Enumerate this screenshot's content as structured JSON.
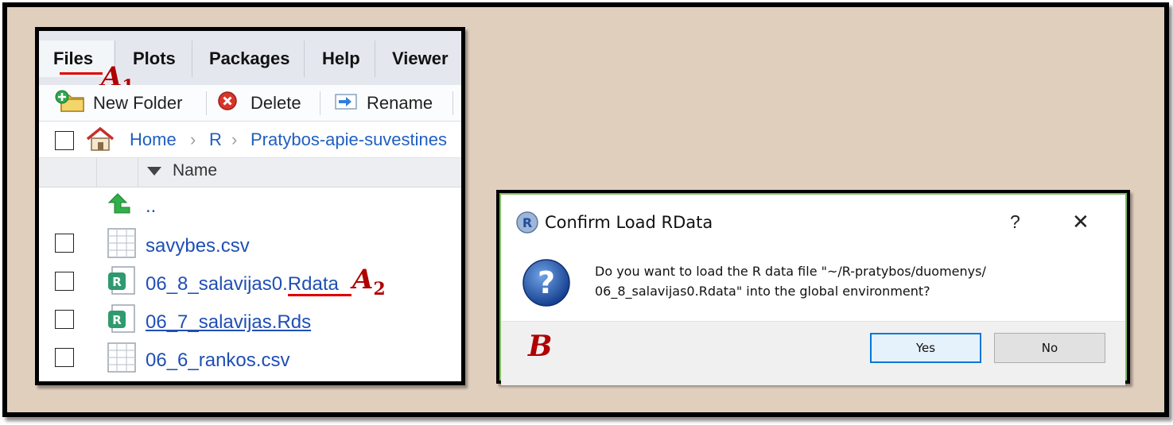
{
  "files_pane": {
    "tabs": [
      {
        "label": "Files",
        "active": true
      },
      {
        "label": "Plots",
        "active": false
      },
      {
        "label": "Packages",
        "active": false
      },
      {
        "label": "Help",
        "active": false
      },
      {
        "label": "Viewer",
        "active": false
      }
    ],
    "toolbar": {
      "new_folder": "New Folder",
      "delete": "Delete",
      "rename": "Rename"
    },
    "breadcrumb": [
      "Home",
      "R",
      "Pratybos-apie-suvestines"
    ],
    "column_header": "Name",
    "parent_dir": "..",
    "files": [
      {
        "name": "savybes.csv",
        "type": "csv"
      },
      {
        "name": "06_8_salavijas0.",
        "ext": "Rdata",
        "type": "rdata"
      },
      {
        "name": "06_7_salavijas.Rds",
        "type": "rds"
      },
      {
        "name": "06_6_rankos.csv",
        "type": "csv"
      }
    ]
  },
  "annotations": {
    "a1": {
      "letter": "A",
      "sub": "1"
    },
    "a2": {
      "letter": "A",
      "sub": "2"
    },
    "b": {
      "letter": "B"
    }
  },
  "dialog": {
    "title": "Confirm Load RData",
    "help_glyph": "?",
    "close_glyph": "✕",
    "message_line1": "Do you want to load the R data file \"~/R-pratybos/duomenys/",
    "message_line2": "06_8_salavijas0.Rdata\" into the global environment?",
    "yes_label": "Yes",
    "no_label": "No"
  },
  "colors": {
    "background": "#e1cfbe",
    "link": "#1f4fb5",
    "annotation": "#b00000",
    "underline": "#e00000",
    "dialog_border": "#7fbf5f"
  }
}
